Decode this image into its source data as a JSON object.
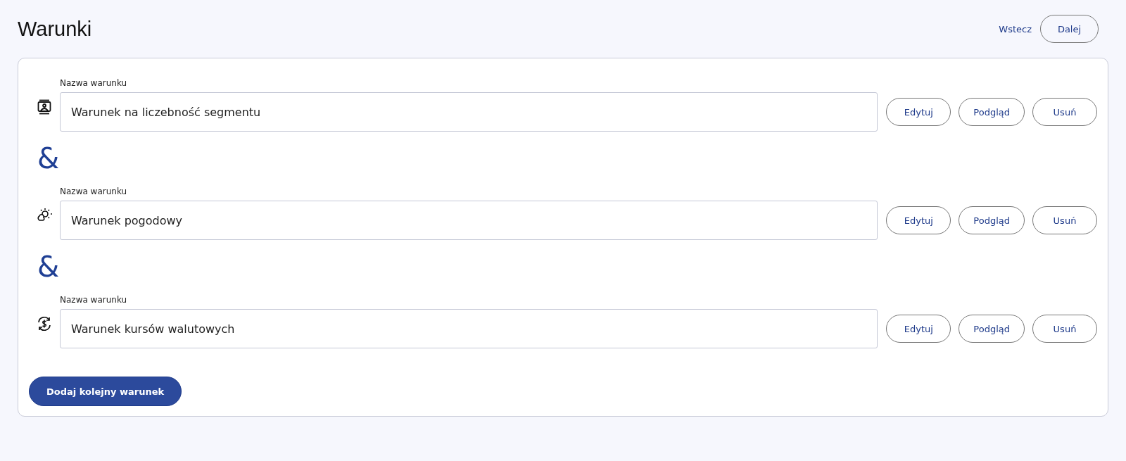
{
  "header": {
    "title": "Warunki",
    "back_link": "Wstecz",
    "next_button": "Dalej"
  },
  "conditions": [
    {
      "kind": "segment",
      "label": "Nazwa warunku",
      "value": "Warunek na liczebność segmentu",
      "actions": [
        "Edytuj",
        "Podgląd",
        "Usuń"
      ]
    },
    {
      "kind": "weather",
      "connector": "&",
      "label": "Nazwa warunku",
      "value": "Warunek pogodowy",
      "actions": [
        "Edytuj",
        "Podgląd",
        "Usuń"
      ]
    },
    {
      "kind": "currency",
      "connector": "&",
      "label": "Nazwa warunku",
      "value": "Warunek kursów walutowych",
      "actions": [
        "Edytuj",
        "Podgląd",
        "Usuń"
      ]
    }
  ],
  "add_button": "Dodaj kolejny warunek"
}
